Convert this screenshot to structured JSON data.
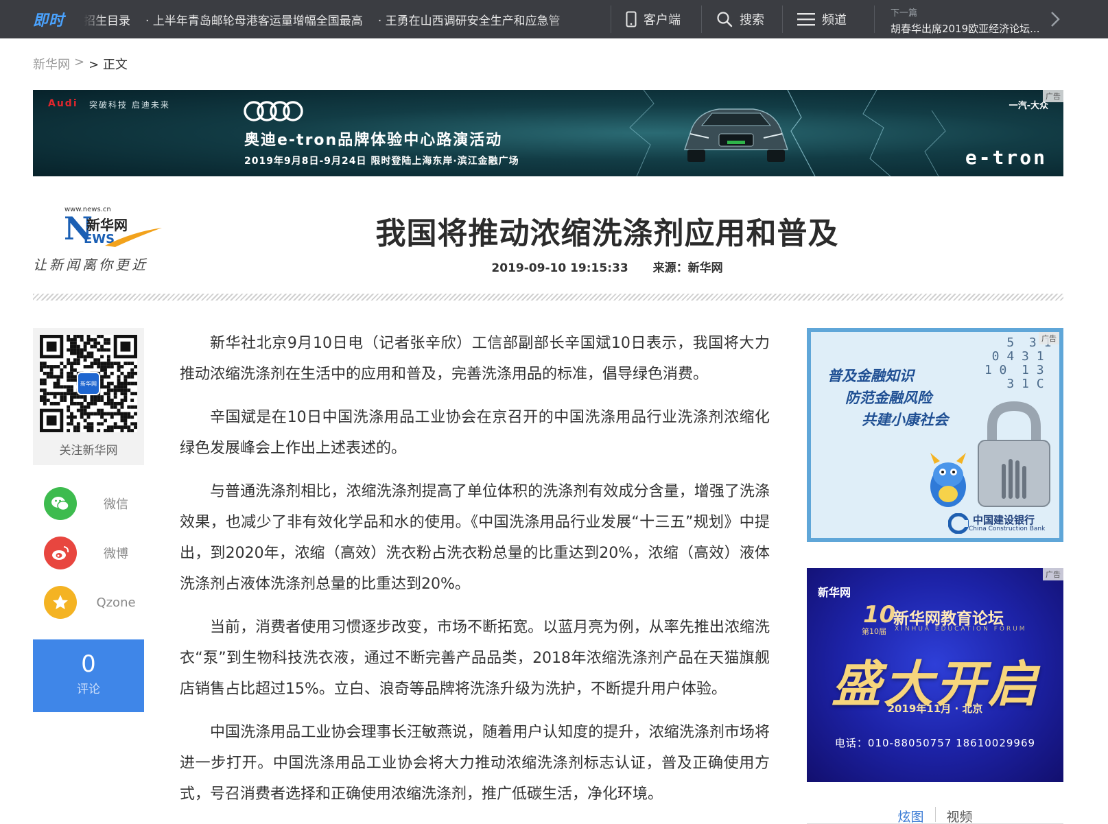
{
  "topbar": {
    "logo_a": "即",
    "logo_b": "时",
    "ticker": [
      "招生目录",
      "· 上半年青岛邮轮母港客运量增幅全国最高",
      "· 王勇在山西调研安全生产和应急管"
    ],
    "client": "客户端",
    "search": "搜索",
    "channel": "频道",
    "next_label": "下一篇",
    "next_title": "胡春华出席2019欧亚经济论坛..."
  },
  "breadcrumb": {
    "home": "新华网",
    "sep": ">",
    "current": "> 正文"
  },
  "banner": {
    "brand_red": "Audi",
    "tagline": "突破科技 启迪未来",
    "title": "奥迪e-tron品牌体验中心路演活动",
    "subtitle": "2019年9月8日-9月24日  限时登陆上海东岸·滨江金融广场",
    "partner": "一汽-大众",
    "product": "e-tron",
    "ad_tag": "广告"
  },
  "site_logo": {
    "url": "www.news.cn",
    "n": "N",
    "cn": "新华网",
    "ews": "EWS",
    "slogan": "让新闻离你更近"
  },
  "article": {
    "title": "我国将推动浓缩洗涤剂应用和普及",
    "datetime": "2019-09-10 19:15:33",
    "source_label": "来源：",
    "source": "新华网",
    "paragraphs": [
      "新华社北京9月10日电（记者张辛欣）工信部副部长辛国斌10日表示，我国将大力推动浓缩洗涤剂在生活中的应用和普及，完善洗涤用品的标准，倡导绿色消费。",
      "辛国斌是在10日中国洗涤用品工业协会在京召开的中国洗涤用品行业洗涤剂浓缩化绿色发展峰会上作出上述表述的。",
      "与普通洗涤剂相比，浓缩洗涤剂提高了单位体积的洗涤剂有效成分含量，增强了洗涤效果，也减少了非有效化学品和水的使用。《中国洗涤用品行业发展“十三五”规划》中提出，到2020年，浓缩（高效）洗衣粉占洗衣粉总量的比重达到20%，浓缩（高效）液体洗涤剂占液体洗涤剂总量的比重达到20%。",
      "当前，消费者使用习惯逐步改变，市场不断拓宽。以蓝月亮为例，从率先推出浓缩洗衣“泵”到生物科技洗衣液，通过不断完善产品品类，2018年浓缩洗涤剂产品在天猫旗舰店销售占比超过15%。立白、浪奇等品牌将洗涤升级为洗护，不断提升用户体验。",
      "中国洗涤用品工业协会理事长汪敏燕说，随着用户认知度的提升，浓缩洗涤剂市场将进一步打开。中国洗涤用品工业协会将大力推动浓缩洗涤剂标志认证，普及正确使用方式，号召消费者选择和正确使用浓缩洗涤剂，推广低碳生活，净化环境。"
    ]
  },
  "share": {
    "qr_label": "关注新华网",
    "qr_center": "新华网",
    "wechat": "微信",
    "weibo": "微博",
    "qzone": "Qzone",
    "comment_count": "0",
    "comment_label": "评论"
  },
  "ad_ccb": {
    "line1": "普及金融知识",
    "line2": "防范金融风险",
    "line3": "共建小康社会",
    "bank_cn": "中国建设银行",
    "bank_en": "China Construction Bank",
    "ad_tag": "广告"
  },
  "ad_edu": {
    "logo": "新华网",
    "ten": "10",
    "th": "第10届",
    "forum": "新华网教育论坛",
    "forum_en": "XINHUA EDUCATION FORUM",
    "big": "盛大开启",
    "date": "2019年11月 · 北京",
    "phone": "电话：010-88050757   18610029969",
    "ad_tag": "广告"
  },
  "tabs": {
    "pics": "炫图",
    "video": "视频"
  }
}
